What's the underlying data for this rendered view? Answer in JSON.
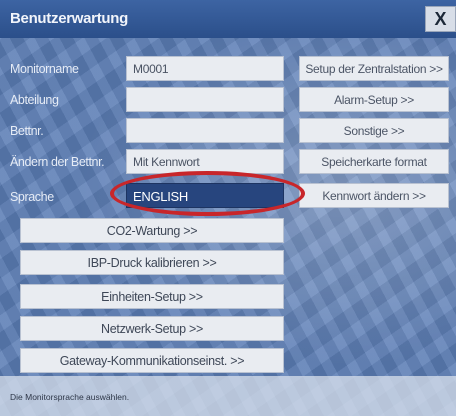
{
  "window": {
    "title": "Benutzerwartung",
    "close_glyph": "X"
  },
  "form": {
    "monitorname": {
      "label": "Monitorname",
      "value": "M0001"
    },
    "abteilung": {
      "label": "Abteilung",
      "value": ""
    },
    "bettnr": {
      "label": "Bettnr.",
      "value": ""
    },
    "bettnr_change": {
      "label": "Ändern der Bettnr.",
      "value": "Mit Kennwort"
    },
    "sprache": {
      "label": "Sprache",
      "value": "ENGLISH"
    }
  },
  "right_buttons": {
    "setup_central": "Setup der Zentralstation >>",
    "alarm_setup": "Alarm-Setup >>",
    "other": "Sonstige >>",
    "format_card": "Speicherkarte format",
    "change_password": "Kennwort ändern >>"
  },
  "wide_buttons": {
    "co2": "CO2-Wartung >>",
    "ibp": "IBP-Druck kalibrieren >>",
    "units": "Einheiten-Setup >>",
    "network": "Netzwerk-Setup >>",
    "gateway": "Gateway-Kommunikationseinst. >>"
  },
  "status_bar": {
    "hint": "Die Monitorsprache auswählen."
  },
  "colors": {
    "annotation_ellipse": "#c8262a",
    "selected_field": "#27457e"
  }
}
